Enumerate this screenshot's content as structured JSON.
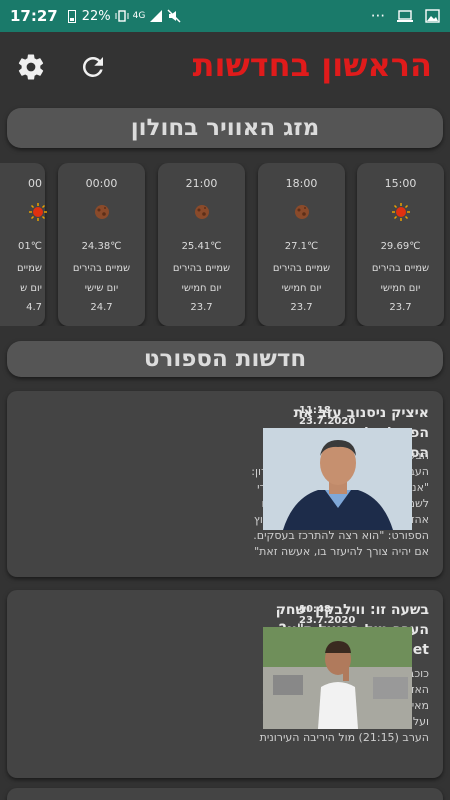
{
  "status_bar": {
    "time": "17:27",
    "battery": "22%",
    "signal_text": "4G",
    "more": "···"
  },
  "header": {
    "title": "הראשון בחדשות"
  },
  "weather": {
    "section_title": "מזג האוויר בחולון",
    "cards": [
      {
        "time": "15:00",
        "icon": "sun-icon",
        "temp": "29.69℃",
        "desc": "שמיים בהירים",
        "day": "יום חמישי",
        "avg": "23.7"
      },
      {
        "time": "18:00",
        "icon": "moon-icon",
        "temp": "27.1℃",
        "desc": "שמיים בהירים",
        "day": "יום חמישי",
        "avg": "23.7"
      },
      {
        "time": "21:00",
        "icon": "moon-icon",
        "temp": "25.41℃",
        "desc": "שמיים בהירים",
        "day": "יום חמישי",
        "avg": "23.7"
      },
      {
        "time": "00:00",
        "icon": "moon-icon",
        "temp": "24.38℃",
        "desc": "שמיים בהירים",
        "day": "יום שישי",
        "avg": "24.7"
      },
      {
        "time": "00",
        "icon": "sun-icon",
        "temp": "01℃",
        "desc": "שמיים",
        "day": "יום ש",
        "avg": "4.7"
      }
    ]
  },
  "sport": {
    "section_title": "חדשות הספורט",
    "items": [
      {
        "title": "איציק ניסנוב עזב את הפועל תל אביב - ערוץ הספורט",
        "date": "23.7.2020",
        "time": "11:18",
        "body": "הבעלים המחזיק ב-37.5% ממניות העביר את סמכויות הניהול לאחיו שרון: \"אני חוזר ליציע, זו הייתה גאווה עבורי לשמש כבעת הבית של המועדון אותו אהדתי מגיל צעיר\". שרון ניסנוב לערוץ הספורט: \"הוא רצה להתרכז בעסקים. אם יהיה צורך להיעזר בו, אעשה זאת\""
      },
      {
        "title": "בשעה זו: ווילבקין ישחק הערב מול הפועל ת\"א? - ynet ידיעות אחרונות",
        "date": "23.7.2020",
        "time": "10:48",
        "body": "כוכב מכבי ת\"א, שהורחק מול האדומים לאחר שנצמד לשופט ניר מאירסון, עומד לדין באיגוד הכדורסל ועלול להחמיץ את המשחק החשוב הערב (21:15) מול היריבה העירונית"
      }
    ]
  }
}
